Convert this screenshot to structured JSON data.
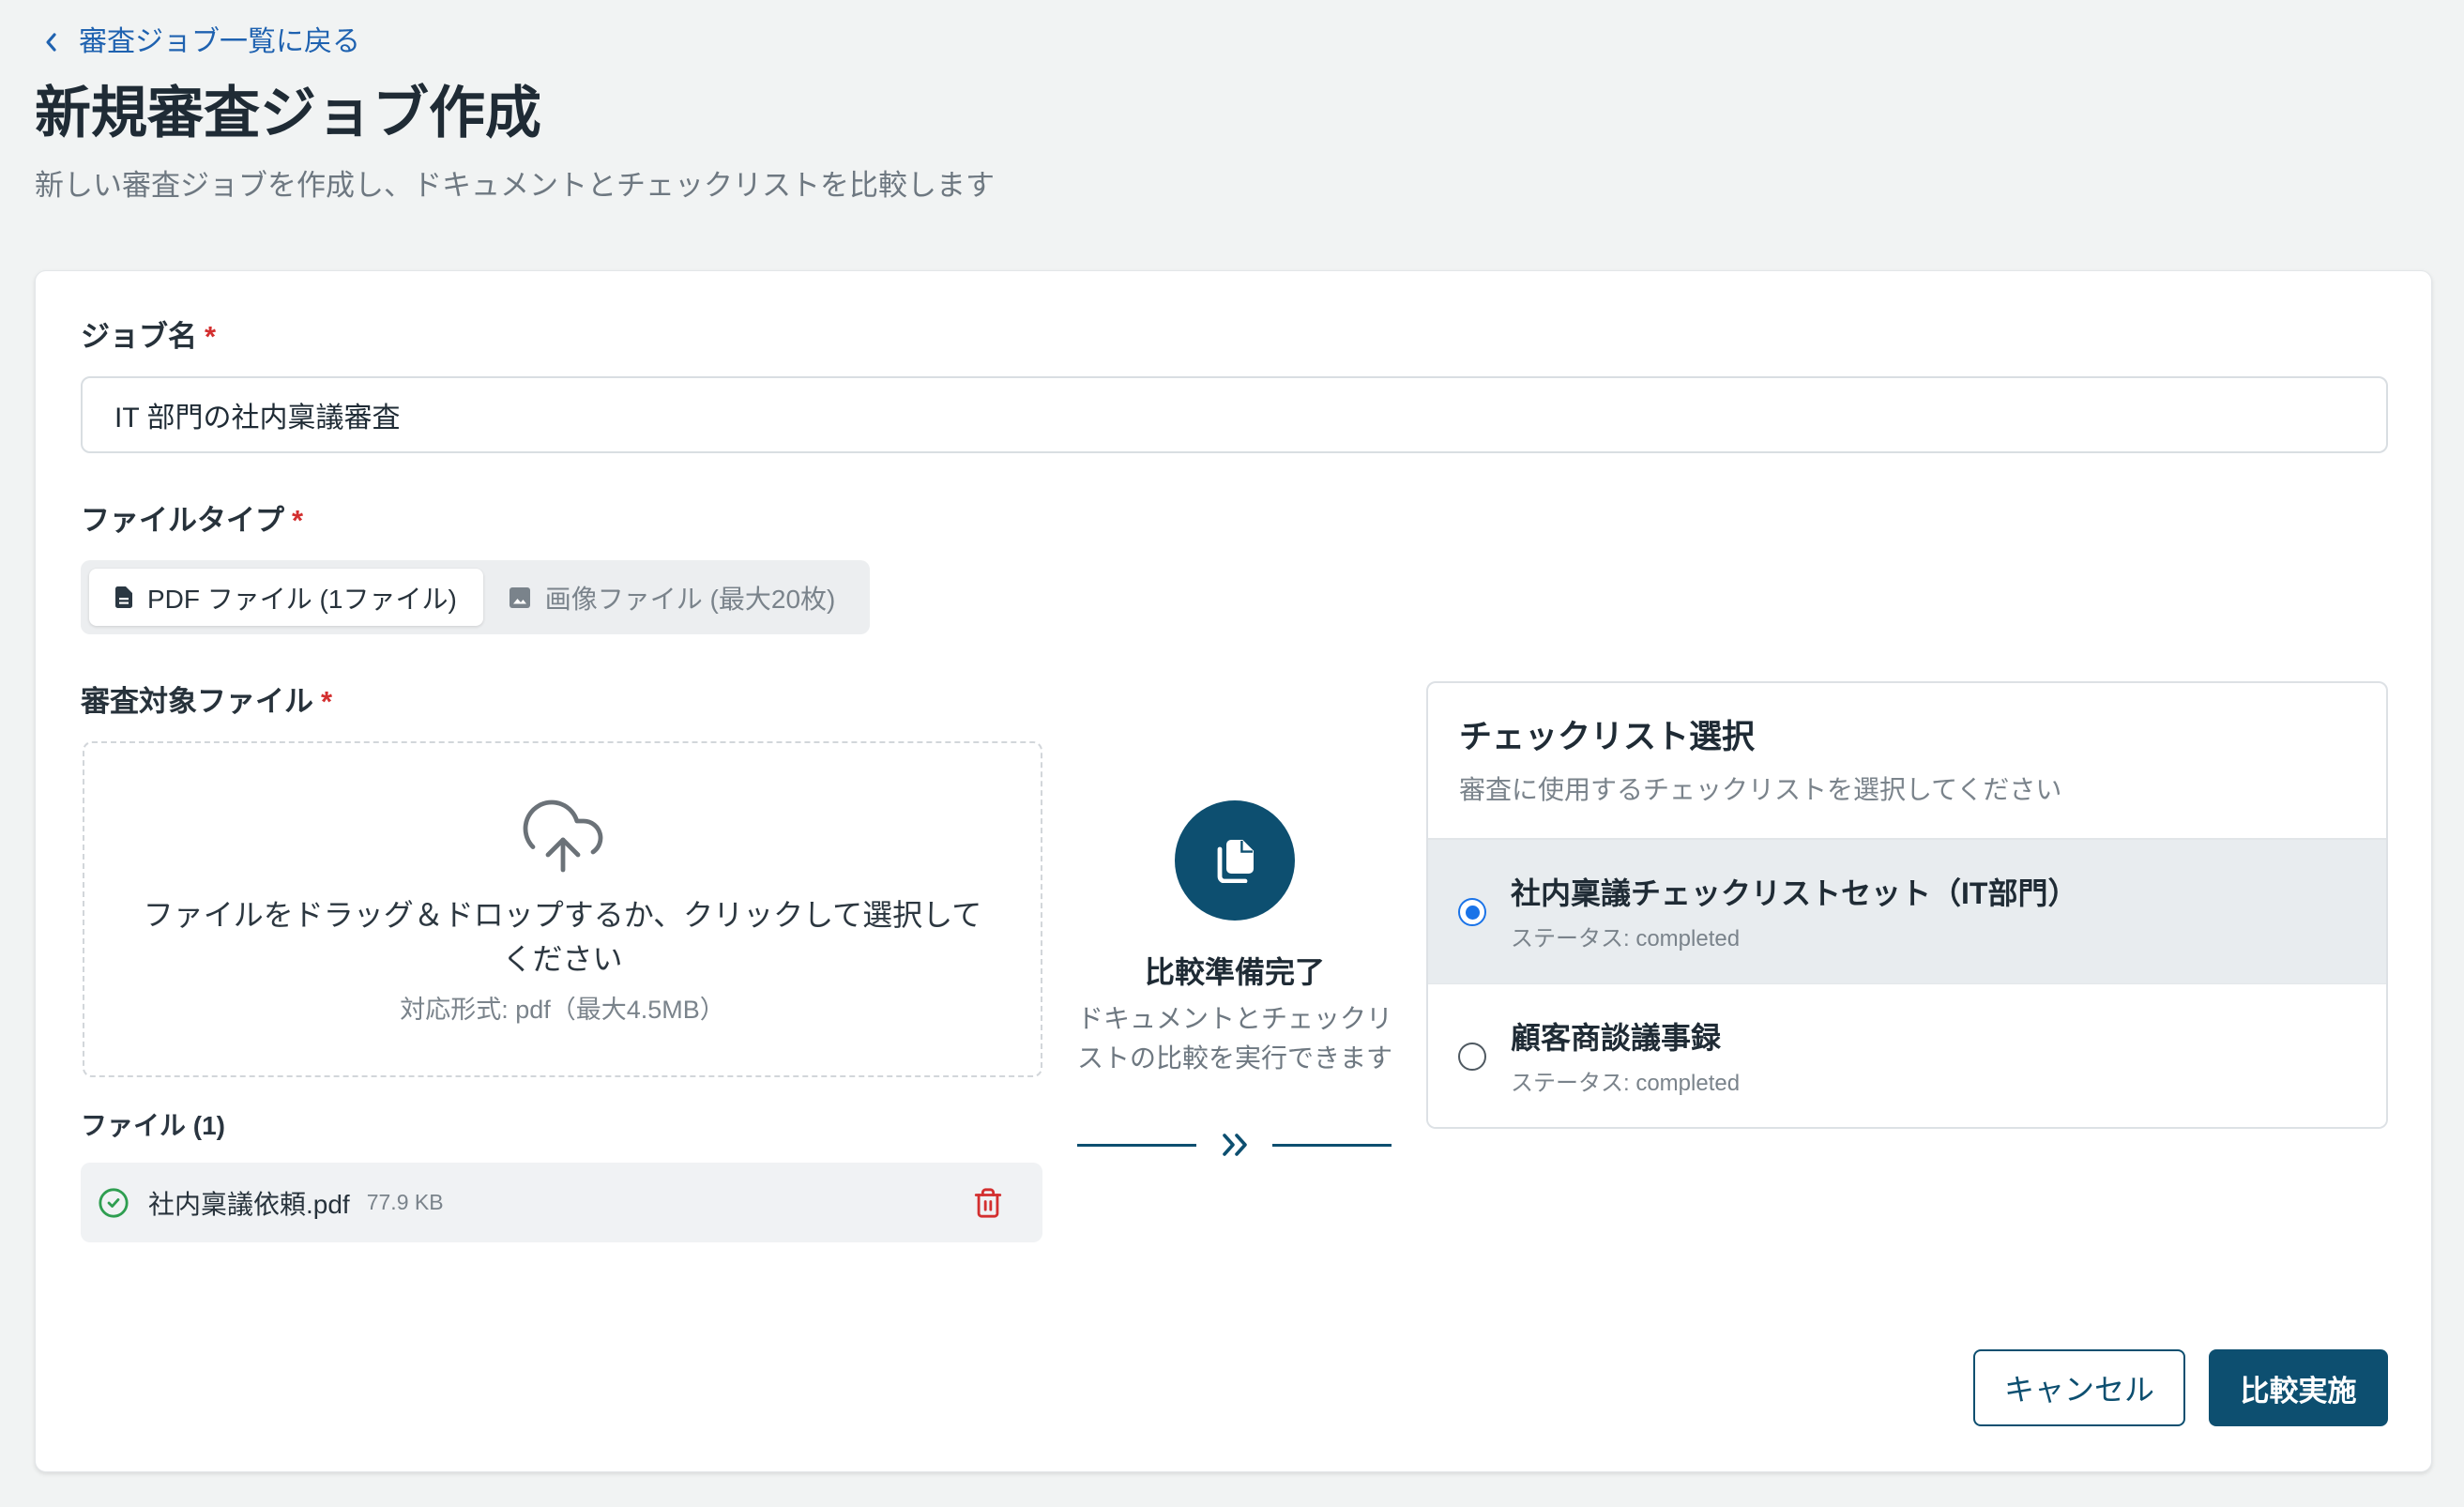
{
  "colors": {
    "primary": "#0d4f70",
    "link": "#1f62b0",
    "required": "#d32f2f",
    "success": "#2e9e50",
    "danger": "#d32f2f",
    "radio_selected": "#1a73e8",
    "page_background": "#f1f3f3",
    "selected_row": "#e8ecef"
  },
  "back_link": {
    "icon": "chevron-left-icon",
    "label": "審査ジョブ一覧に戻る"
  },
  "header": {
    "title": "新規審査ジョブ作成",
    "subtitle": "新しい審査ジョブを作成し、ドキュメントとチェックリストを比較します"
  },
  "form": {
    "job_name": {
      "label": "ジョブ名",
      "required_mark": "*",
      "value": "IT 部門の社内稟議審査"
    },
    "file_type": {
      "label": "ファイルタイプ",
      "required_mark": "*",
      "options": [
        {
          "icon": "document-icon",
          "label": "PDF ファイル (1ファイル)",
          "selected": true
        },
        {
          "icon": "image-icon",
          "label": "画像ファイル (最大20枚)",
          "selected": false
        }
      ]
    },
    "target_file": {
      "label": "審査対象ファイル",
      "required_mark": "*",
      "dropzone": {
        "icon": "cloud-upload-icon",
        "instruction": "ファイルをドラッグ＆ドロップするか、クリックして選択してください",
        "formats": "対応形式: pdf（最大4.5MB）"
      },
      "files_heading": "ファイル (1)",
      "files": [
        {
          "status_icon": "check-circle-icon",
          "name": "社内稟議依頼.pdf",
          "size": "77.9 KB",
          "delete_icon": "trash-icon"
        }
      ]
    }
  },
  "compare_status": {
    "icon": "copy-icon",
    "title": "比較準備完了",
    "description": "ドキュメントとチェックリストの比較を実行できます",
    "connector_icon": "double-chevron-right-icon"
  },
  "checklist": {
    "title": "チェックリスト選択",
    "subtitle": "審査に使用するチェックリストを選択してください",
    "items": [
      {
        "name": "社内稟議チェックリストセット（IT部門）",
        "status": "ステータス: completed",
        "selected": true
      },
      {
        "name": "顧客商談議事録",
        "status": "ステータス: completed",
        "selected": false
      }
    ]
  },
  "actions": {
    "cancel_label": "キャンセル",
    "submit_label": "比較実施"
  }
}
